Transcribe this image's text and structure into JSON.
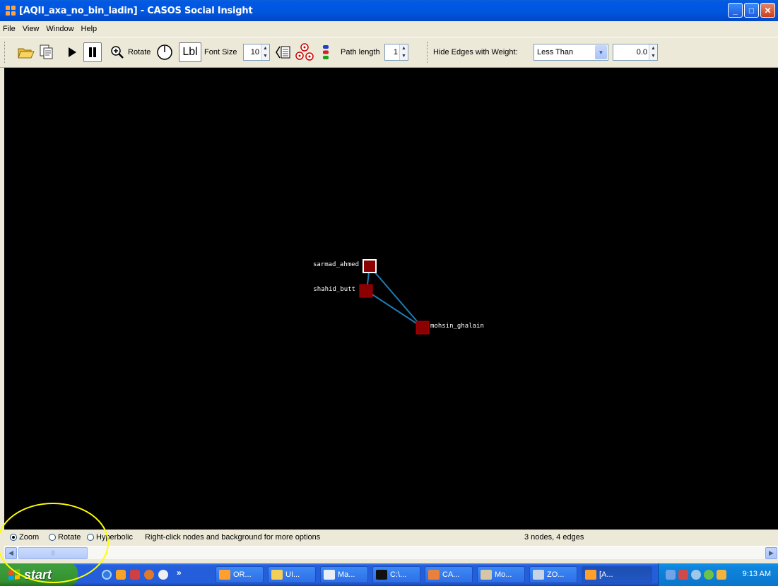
{
  "window": {
    "title": "[AQII_axa_no_bin_ladin] - CASOS Social Insight",
    "minimize_glyph": "_",
    "maximize_glyph": "□",
    "close_glyph": "✕"
  },
  "menu": [
    "File",
    "View",
    "Window",
    "Help"
  ],
  "toolbar": {
    "rotate_label": "Rotate",
    "lbl_label": "Lbl",
    "font_size_label": "Font Size",
    "font_size_value": "10",
    "path_length_label": "Path length",
    "path_length_value": "1",
    "hide_edges_label": "Hide Edges with Weight:",
    "comparison_value": "Less Than",
    "weight_value": "0.0",
    "icons": [
      "open-folder-icon",
      "copy-icon",
      "play-icon",
      "pause-icon",
      "zoom-icon",
      "rotate-dial-icon",
      "layout-icon",
      "cluster-icon",
      "legend-icon"
    ]
  },
  "graph": {
    "nodes": [
      {
        "id": "sarmad_ahmed",
        "label": "sarmad_ahmed",
        "selected": true
      },
      {
        "id": "shahid_butt",
        "label": "shahid_butt",
        "selected": false
      },
      {
        "id": "mohsin_ghalain",
        "label": "mohsin_ghalain",
        "selected": false
      }
    ],
    "edges": [
      [
        "sarmad_ahmed",
        "shahid_butt"
      ],
      [
        "sarmad_ahmed",
        "mohsin_ghalain"
      ],
      [
        "shahid_butt",
        "mohsin_ghalain"
      ]
    ],
    "node_color": "#8b0000",
    "edge_color": "#1e7bb5",
    "background": "#000000"
  },
  "status": {
    "modes": [
      "Zoom",
      "Rotate",
      "Hyperbolic"
    ],
    "selected_mode": "Zoom",
    "hint": "Right-click nodes and background for more options",
    "count": "3 nodes, 4 edges"
  },
  "taskbar": {
    "start_label": "start",
    "overflow_glyph": "»",
    "tasks": [
      "OR...",
      "UI...",
      "Ma...",
      "C:\\...",
      "CA...",
      "Mo...",
      "ZO...",
      "[A..."
    ],
    "clock": "9:13 AM"
  }
}
